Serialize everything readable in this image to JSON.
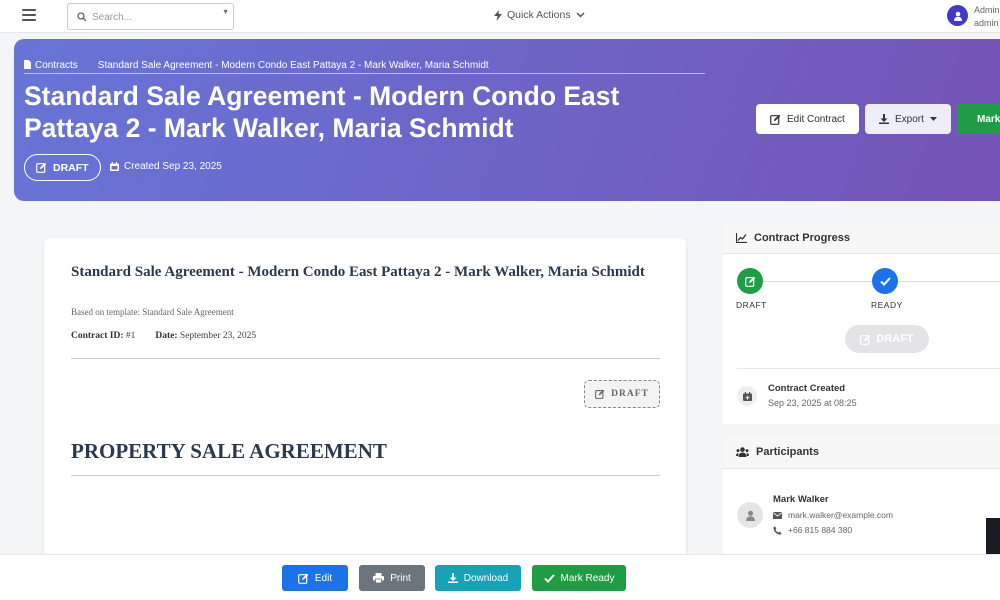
{
  "topbar": {
    "search_placeholder": "Search...",
    "quick_actions_label": "Quick Actions",
    "user_name": "Admin",
    "user_role": "admin"
  },
  "hero": {
    "breadcrumb_root": "Contracts",
    "breadcrumb_current": "Standard Sale Agreement - Modern Condo East Pattaya 2 - Mark Walker, Maria Schmidt",
    "title": "Standard Sale Agreement - Modern Condo East Pattaya 2 - Mark Walker, Maria Schmidt",
    "status_label": "DRAFT",
    "created_label": "Created Sep 23, 2025",
    "edit_contract_label": "Edit Contract",
    "export_label": "Export",
    "mark_ready_label": "Mark Ready"
  },
  "document": {
    "title": "Standard Sale Agreement - Modern Condo East Pattaya 2 - Mark Walker, Maria Schmidt",
    "template_note": "Based on template: Standard Sale Agreement",
    "contract_id_label": "Contract ID:",
    "contract_id_value": "#1",
    "date_label": "Date:",
    "date_value": "September 23, 2025",
    "stamp_label": "DRAFT",
    "heading": "PROPERTY SALE AGREEMENT"
  },
  "progress": {
    "title": "Contract Progress",
    "steps": [
      {
        "label": "DRAFT",
        "state": "done"
      },
      {
        "label": "READY",
        "state": "current"
      }
    ],
    "current_button_label": "DRAFT",
    "timeline_title": "Contract Created",
    "timeline_date": "Sep 23, 2025 at 08:25"
  },
  "participants": {
    "title": "Participants",
    "items": [
      {
        "name": "Mark Walker",
        "email": "mark.walker@example.com",
        "phone": "+66 815 884 380"
      }
    ]
  },
  "bottombar": {
    "edit_label": "Edit",
    "print_label": "Print",
    "download_label": "Download",
    "mark_ready_label": "Mark Ready"
  },
  "colors": {
    "primary": "#1a73e8",
    "success": "#1f9d45",
    "secondary": "#6c757d",
    "info": "#17a2b8",
    "hero_start": "#6775d7",
    "hero_end": "#7553b5"
  }
}
